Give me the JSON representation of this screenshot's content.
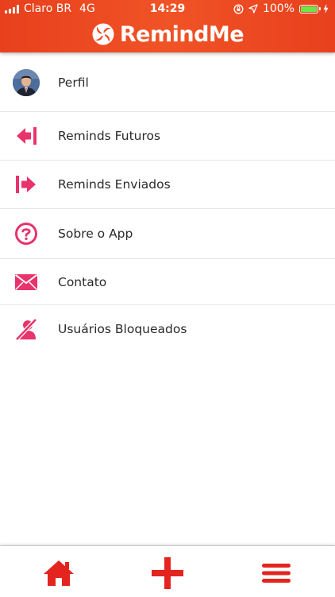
{
  "status_bar": {
    "carrier": "Claro BR",
    "network": "4G",
    "time": "14:29",
    "battery": "100%"
  },
  "header": {
    "app_name": "RemindMe"
  },
  "menu": {
    "items": [
      {
        "label": "Perfil",
        "icon": "avatar"
      },
      {
        "label": "Reminds Futuros",
        "icon": "arrow-left-bar-icon"
      },
      {
        "label": "Reminds Enviados",
        "icon": "arrow-right-bar-icon"
      },
      {
        "label": "Sobre o App",
        "icon": "question-circle-icon"
      },
      {
        "label": "Contato",
        "icon": "envelope-icon"
      },
      {
        "label": "Usuários Bloqueados",
        "icon": "user-blocked-icon"
      }
    ]
  },
  "tabbar": {
    "items": [
      "home-icon",
      "plus-icon",
      "menu-icon"
    ]
  },
  "colors": {
    "header": "#ee4a22",
    "accent": "#e8336c",
    "tab_icons": "#e3241f",
    "battery": "#6ee34b"
  }
}
